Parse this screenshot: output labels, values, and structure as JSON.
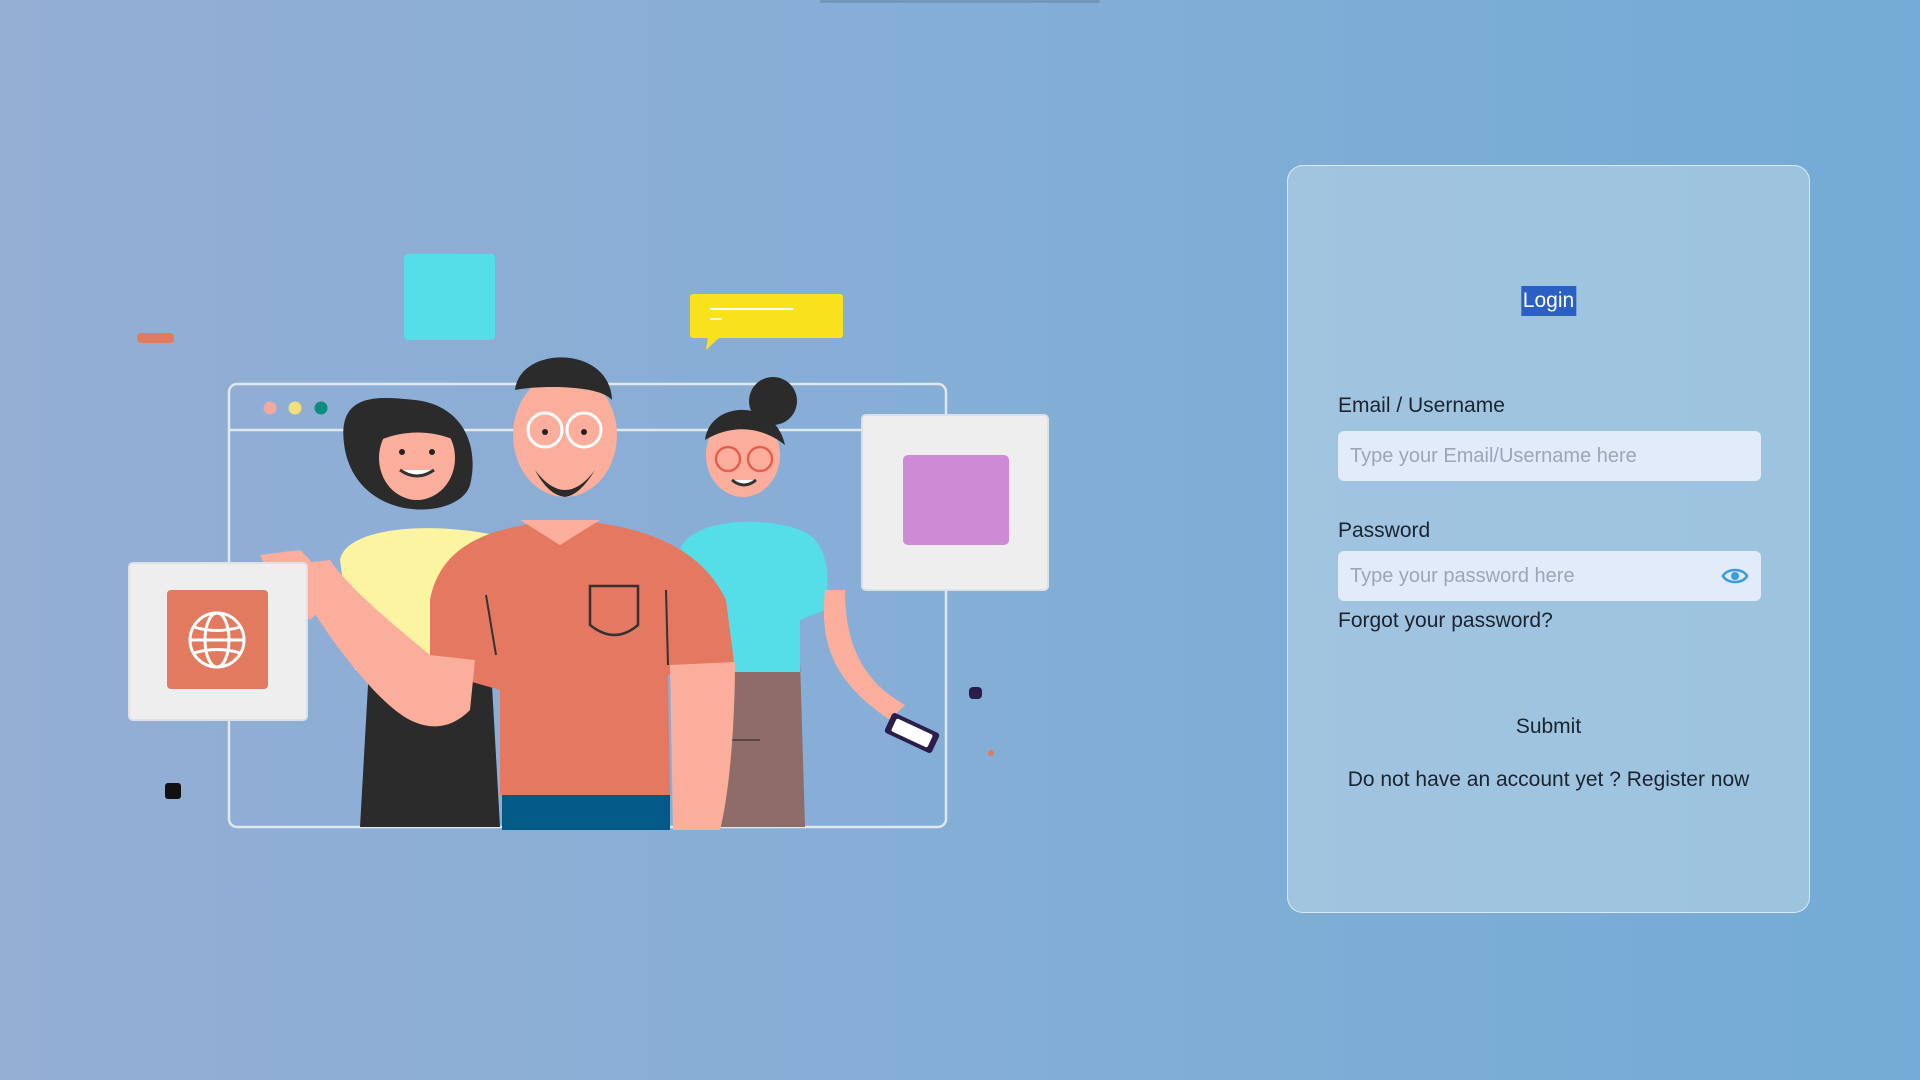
{
  "login": {
    "title": "Login",
    "email_label": "Email / Username",
    "email_placeholder": "Type your Email/Username here",
    "password_label": "Password",
    "password_placeholder": "Type your password here",
    "forgot_label": "Forgot your password?",
    "submit_label": "Submit",
    "register_prompt": "Do not have an account yet ?",
    "register_link": "Register now"
  },
  "icons": {
    "password_toggle": "eye-icon",
    "globe": "globe-icon"
  },
  "colors": {
    "title_highlight": "#2a5fc4",
    "input_bg": "#e1ebfa",
    "eye_icon": "#3d9be0"
  }
}
